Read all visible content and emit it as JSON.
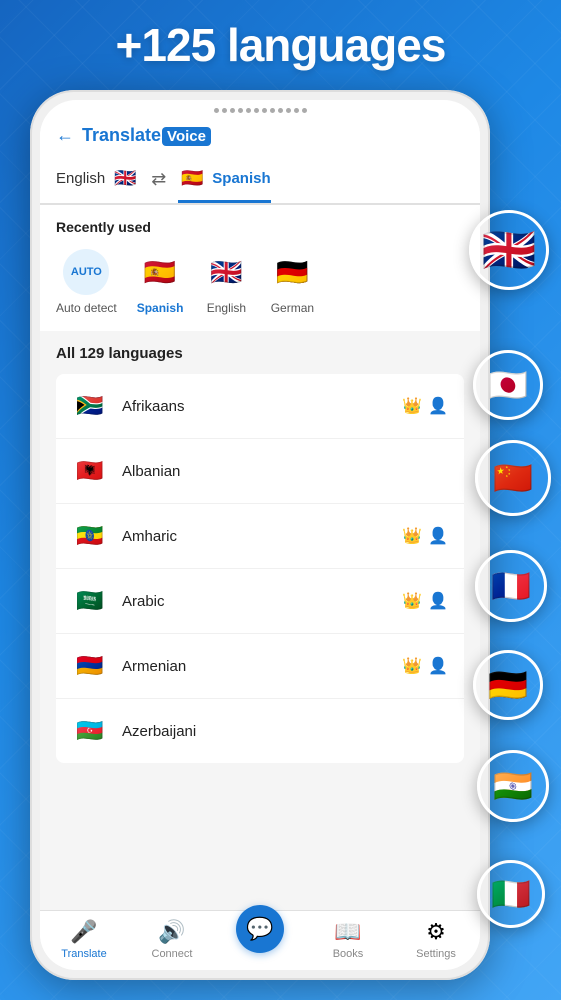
{
  "hero": {
    "title": "+125 languages"
  },
  "app": {
    "back_label": "←",
    "logo_text": "Translate",
    "logo_badge": "Voice"
  },
  "lang_selector": {
    "source_lang": "English",
    "source_flag": "🇬🇧",
    "swap_icon": "⇄",
    "target_lang": "Spanish",
    "target_flag": "🇪🇸"
  },
  "recently_used": {
    "title": "Recently used",
    "items": [
      {
        "label": "Auto detect",
        "flag": "AUTO",
        "type": "auto"
      },
      {
        "label": "Spanish",
        "flag": "🇪🇸",
        "type": "flag",
        "highlight": true
      },
      {
        "label": "English",
        "flag": "🇬🇧",
        "type": "flag"
      },
      {
        "label": "German",
        "flag": "🇩🇪",
        "type": "flag"
      }
    ]
  },
  "all_languages": {
    "title": "All 129 languages",
    "items": [
      {
        "name": "Afrikaans",
        "flag": "🇿🇦",
        "crown": true,
        "voice": true
      },
      {
        "name": "Albanian",
        "flag": "🇦🇱",
        "crown": false,
        "voice": false
      },
      {
        "name": "Amharic",
        "flag": "🇪🇹",
        "crown": true,
        "voice": true
      },
      {
        "name": "Arabic",
        "flag": "🇸🇦",
        "crown": true,
        "voice": true
      },
      {
        "name": "Armenian",
        "flag": "🇦🇲",
        "crown": true,
        "voice": true
      },
      {
        "name": "Azerbaijani",
        "flag": "🇦🇿",
        "crown": false,
        "voice": false
      }
    ]
  },
  "bottom_nav": {
    "items": [
      {
        "label": "Translate",
        "icon": "🎤",
        "active": true
      },
      {
        "label": "Connect",
        "icon": "🔊",
        "active": false
      },
      {
        "label": "",
        "icon": "💬",
        "active": false,
        "center": true
      },
      {
        "label": "Books",
        "icon": "📖",
        "active": false
      },
      {
        "label": "Settings",
        "icon": "⚙",
        "active": false
      }
    ]
  },
  "floating_flags": [
    {
      "emoji": "🇬🇧",
      "class": "uk"
    },
    {
      "emoji": "🇯🇵",
      "class": "jp"
    },
    {
      "emoji": "🇨🇳",
      "class": "cn"
    },
    {
      "emoji": "🇫🇷",
      "class": "fr"
    },
    {
      "emoji": "🇩🇪",
      "class": "de"
    },
    {
      "emoji": "🇮🇳",
      "class": "in"
    },
    {
      "emoji": "🇮🇹",
      "class": "it"
    }
  ]
}
